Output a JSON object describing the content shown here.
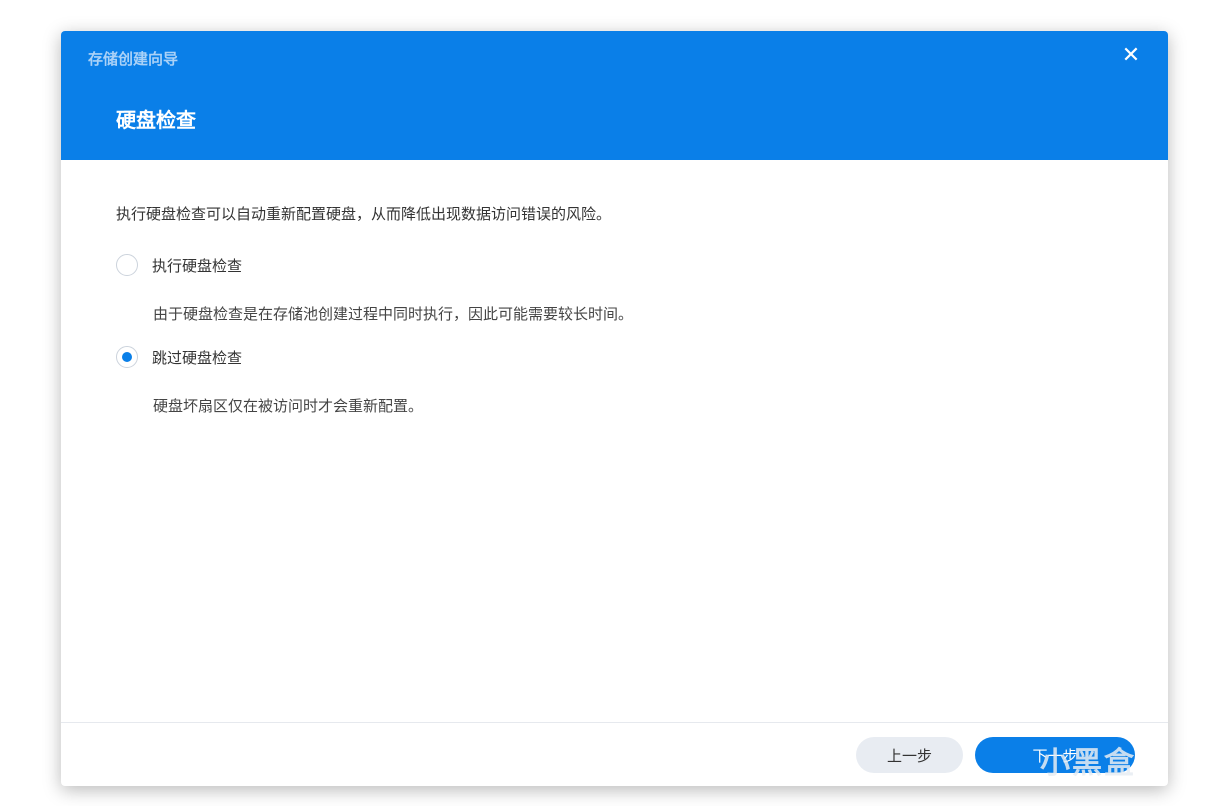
{
  "dialog": {
    "wizard_title": "存储创建向导",
    "step_title": "硬盘检查",
    "close_icon": "close-icon",
    "description": "执行硬盘检查可以自动重新配置硬盘，从而降低出现数据访问错误的风险。",
    "options": [
      {
        "label": "执行硬盘检查",
        "hint": "由于硬盘检查是在存储池创建过程中同时执行，因此可能需要较长时间。",
        "selected": false
      },
      {
        "label": "跳过硬盘检查",
        "hint": "硬盘坏扇区仅在被访问时才会重新配置。",
        "selected": true
      }
    ],
    "buttons": {
      "prev": "上一步",
      "next": "下一步"
    },
    "accent_color": "#0a7fe8"
  },
  "watermark": "小黑盒"
}
